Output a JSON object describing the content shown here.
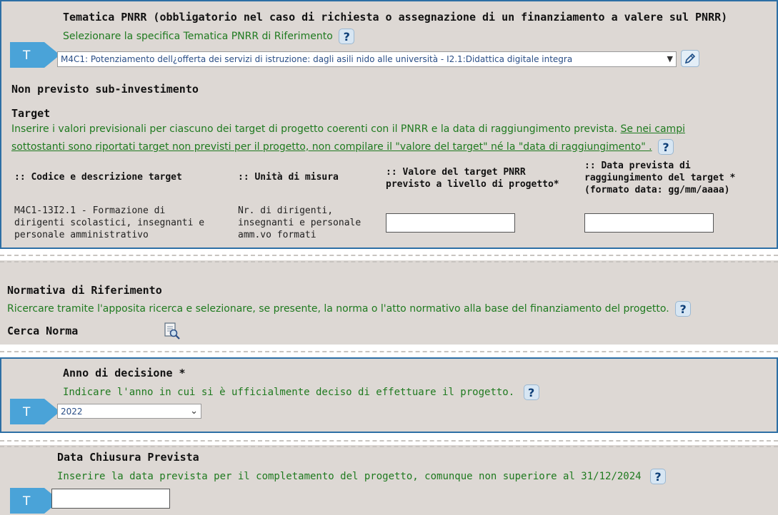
{
  "pnrr": {
    "title": "Tematica PNRR (obbligatorio nel caso di richiesta o assegnazione di un finanziamento a valere sul PNRR)",
    "hint": "Selezionare la specifica Tematica PNRR di Riferimento",
    "badge": "T",
    "selected": "M4C1: Potenziamento dell¿offerta dei servizi di istruzione: dagli asili nido alle università - I2.1:Didattica digitale integra",
    "help": "?"
  },
  "subinvest": {
    "label": "Non previsto sub-investimento"
  },
  "target": {
    "title": "Target",
    "desc_line1": "Inserire i valori previsionali per ciascuno dei target di progetto coerenti con il PNRR e la data di raggiungimento prevista.",
    "desc_link1": "Se nei campi",
    "desc_link2": "sottostanti sono riportati target non previsti per il progetto, non compilare il \"valore del target\" né la \"data di raggiungimento\" .",
    "help": "?",
    "headers": {
      "codice": ":: Codice e descrizione target",
      "unita": ":: Unità di misura",
      "valore_1": ":: Valore del target PNRR",
      "valore_2": "previsto a livello di progetto*",
      "data_1": ":: Data prevista di",
      "data_2": "raggiungimento del target *",
      "data_3": "(formato data: gg/mm/aaaa)"
    },
    "row": {
      "codice_1": "M4C1-13I2.1 - Formazione di",
      "codice_2": "dirigenti scolastici, insegnanti e",
      "codice_3": "personale amministrativo",
      "unita_1": "Nr. di dirigenti,",
      "unita_2": "insegnanti e personale",
      "unita_3": "amm.vo formati",
      "valore": "",
      "data": ""
    }
  },
  "normativa": {
    "title": "Normativa di Riferimento",
    "hint": "Ricercare tramite l'apposita ricerca e selezionare, se presente, la norma o l'atto normativo alla base del finanziamento del progetto.",
    "help": "?",
    "cerca_label": "Cerca Norma"
  },
  "anno": {
    "title": "Anno di decisione *",
    "hint": "Indicare l'anno in cui si è ufficialmente deciso di effettuare il progetto.",
    "help": "?",
    "badge": "T",
    "selected": "2022"
  },
  "chiusura": {
    "title": "Data Chiusura Prevista",
    "hint": "Inserire la data prevista per il completamento del progetto, comunque non superiore al 31/12/2024",
    "help": "?",
    "badge": "T",
    "value": ""
  },
  "colors": {
    "border": "#2d6fa5",
    "panel": "#ddd8d4",
    "hint": "#1f7a1f",
    "badge": "#4aa3d8"
  },
  "icons": {
    "edit": "pencil-icon",
    "search_doc": "search-document-icon",
    "chevron": "chevron-down-icon",
    "badge": "t-arrow-badge-icon"
  }
}
